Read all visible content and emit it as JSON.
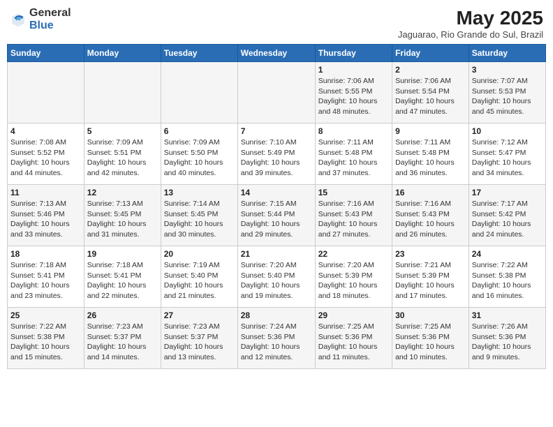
{
  "header": {
    "logo_general": "General",
    "logo_blue": "Blue",
    "title": "May 2025",
    "subtitle": "Jaguarao, Rio Grande do Sul, Brazil"
  },
  "days_of_week": [
    "Sunday",
    "Monday",
    "Tuesday",
    "Wednesday",
    "Thursday",
    "Friday",
    "Saturday"
  ],
  "weeks": [
    [
      {
        "day": "",
        "info": ""
      },
      {
        "day": "",
        "info": ""
      },
      {
        "day": "",
        "info": ""
      },
      {
        "day": "",
        "info": ""
      },
      {
        "day": "1",
        "info": "Sunrise: 7:06 AM\nSunset: 5:55 PM\nDaylight: 10 hours\nand 48 minutes."
      },
      {
        "day": "2",
        "info": "Sunrise: 7:06 AM\nSunset: 5:54 PM\nDaylight: 10 hours\nand 47 minutes."
      },
      {
        "day": "3",
        "info": "Sunrise: 7:07 AM\nSunset: 5:53 PM\nDaylight: 10 hours\nand 45 minutes."
      }
    ],
    [
      {
        "day": "4",
        "info": "Sunrise: 7:08 AM\nSunset: 5:52 PM\nDaylight: 10 hours\nand 44 minutes."
      },
      {
        "day": "5",
        "info": "Sunrise: 7:09 AM\nSunset: 5:51 PM\nDaylight: 10 hours\nand 42 minutes."
      },
      {
        "day": "6",
        "info": "Sunrise: 7:09 AM\nSunset: 5:50 PM\nDaylight: 10 hours\nand 40 minutes."
      },
      {
        "day": "7",
        "info": "Sunrise: 7:10 AM\nSunset: 5:49 PM\nDaylight: 10 hours\nand 39 minutes."
      },
      {
        "day": "8",
        "info": "Sunrise: 7:11 AM\nSunset: 5:48 PM\nDaylight: 10 hours\nand 37 minutes."
      },
      {
        "day": "9",
        "info": "Sunrise: 7:11 AM\nSunset: 5:48 PM\nDaylight: 10 hours\nand 36 minutes."
      },
      {
        "day": "10",
        "info": "Sunrise: 7:12 AM\nSunset: 5:47 PM\nDaylight: 10 hours\nand 34 minutes."
      }
    ],
    [
      {
        "day": "11",
        "info": "Sunrise: 7:13 AM\nSunset: 5:46 PM\nDaylight: 10 hours\nand 33 minutes."
      },
      {
        "day": "12",
        "info": "Sunrise: 7:13 AM\nSunset: 5:45 PM\nDaylight: 10 hours\nand 31 minutes."
      },
      {
        "day": "13",
        "info": "Sunrise: 7:14 AM\nSunset: 5:45 PM\nDaylight: 10 hours\nand 30 minutes."
      },
      {
        "day": "14",
        "info": "Sunrise: 7:15 AM\nSunset: 5:44 PM\nDaylight: 10 hours\nand 29 minutes."
      },
      {
        "day": "15",
        "info": "Sunrise: 7:16 AM\nSunset: 5:43 PM\nDaylight: 10 hours\nand 27 minutes."
      },
      {
        "day": "16",
        "info": "Sunrise: 7:16 AM\nSunset: 5:43 PM\nDaylight: 10 hours\nand 26 minutes."
      },
      {
        "day": "17",
        "info": "Sunrise: 7:17 AM\nSunset: 5:42 PM\nDaylight: 10 hours\nand 24 minutes."
      }
    ],
    [
      {
        "day": "18",
        "info": "Sunrise: 7:18 AM\nSunset: 5:41 PM\nDaylight: 10 hours\nand 23 minutes."
      },
      {
        "day": "19",
        "info": "Sunrise: 7:18 AM\nSunset: 5:41 PM\nDaylight: 10 hours\nand 22 minutes."
      },
      {
        "day": "20",
        "info": "Sunrise: 7:19 AM\nSunset: 5:40 PM\nDaylight: 10 hours\nand 21 minutes."
      },
      {
        "day": "21",
        "info": "Sunrise: 7:20 AM\nSunset: 5:40 PM\nDaylight: 10 hours\nand 19 minutes."
      },
      {
        "day": "22",
        "info": "Sunrise: 7:20 AM\nSunset: 5:39 PM\nDaylight: 10 hours\nand 18 minutes."
      },
      {
        "day": "23",
        "info": "Sunrise: 7:21 AM\nSunset: 5:39 PM\nDaylight: 10 hours\nand 17 minutes."
      },
      {
        "day": "24",
        "info": "Sunrise: 7:22 AM\nSunset: 5:38 PM\nDaylight: 10 hours\nand 16 minutes."
      }
    ],
    [
      {
        "day": "25",
        "info": "Sunrise: 7:22 AM\nSunset: 5:38 PM\nDaylight: 10 hours\nand 15 minutes."
      },
      {
        "day": "26",
        "info": "Sunrise: 7:23 AM\nSunset: 5:37 PM\nDaylight: 10 hours\nand 14 minutes."
      },
      {
        "day": "27",
        "info": "Sunrise: 7:23 AM\nSunset: 5:37 PM\nDaylight: 10 hours\nand 13 minutes."
      },
      {
        "day": "28",
        "info": "Sunrise: 7:24 AM\nSunset: 5:36 PM\nDaylight: 10 hours\nand 12 minutes."
      },
      {
        "day": "29",
        "info": "Sunrise: 7:25 AM\nSunset: 5:36 PM\nDaylight: 10 hours\nand 11 minutes."
      },
      {
        "day": "30",
        "info": "Sunrise: 7:25 AM\nSunset: 5:36 PM\nDaylight: 10 hours\nand 10 minutes."
      },
      {
        "day": "31",
        "info": "Sunrise: 7:26 AM\nSunset: 5:36 PM\nDaylight: 10 hours\nand 9 minutes."
      }
    ]
  ]
}
